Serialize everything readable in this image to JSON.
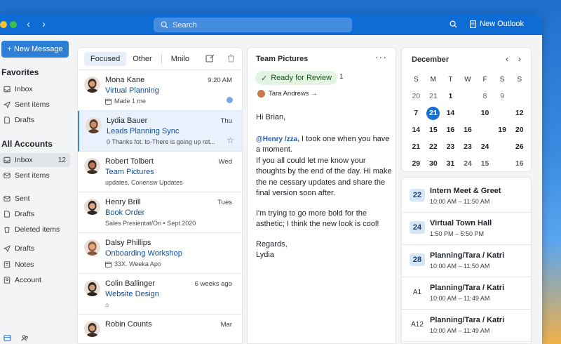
{
  "titlebar": {
    "search_placeholder": "Search",
    "new_outlook_label": "New Outlook"
  },
  "sidebar": {
    "new_message_label": "+ New Message",
    "favorites_title": "Favorites",
    "favorites": [
      {
        "label": "Inbox",
        "icon": "inbox-icon"
      },
      {
        "label": "Sent items",
        "icon": "send-icon"
      },
      {
        "label": "Drafts",
        "icon": "drafts-icon"
      }
    ],
    "accounts_title": "All Accounts",
    "accounts": [
      {
        "label": "Inbox",
        "count": "12",
        "icon": "inbox-icon"
      },
      {
        "label": "Sent items",
        "icon": "sent-icon"
      },
      {
        "label": "Sent",
        "icon": "sent-icon"
      },
      {
        "label": "Drafts",
        "icon": "drafts-icon"
      },
      {
        "label": "Deleted items",
        "icon": "trash-icon"
      },
      {
        "label": "Drafts",
        "icon": "send-icon"
      },
      {
        "label": "Notes",
        "icon": "notes-icon"
      },
      {
        "label": "Account",
        "icon": "account-icon"
      }
    ]
  },
  "list": {
    "tabs": [
      "Focused",
      "Other",
      "Mnilo"
    ],
    "mails": [
      {
        "sender": "Mona Kane",
        "subject": "Virtual Planning",
        "preview": "Made 1 me",
        "time": "9:20 AM",
        "unread": true
      },
      {
        "sender": "Lydia Bauer",
        "subject": "Leads Planning Sync",
        "preview": "0  Thanks fot. to-There is going up ret...",
        "time": "Thu",
        "selected": true
      },
      {
        "sender": "Robert Tolbert",
        "subject": "Team Pictures",
        "preview": "updates, Conensw Updates",
        "time": "Wed"
      },
      {
        "sender": "Henry Brill",
        "subject": "Book Order",
        "preview": "Sales Presientat/Ori • Sept.2020",
        "time": "Tues"
      },
      {
        "sender": "Dalsy Phillips",
        "subject": "Onboarding Workshop",
        "preview": "33X. Weeka Apo",
        "time": ""
      },
      {
        "sender": "Colin Ballinger",
        "subject": "Website Design",
        "preview": "",
        "time": "6 weeks ago"
      },
      {
        "sender": "Robin Counts",
        "subject": "",
        "preview": "",
        "time": "Mar"
      }
    ]
  },
  "reading": {
    "title": "Team Pictures",
    "status_label": "Ready for Review",
    "status_count": "1",
    "from": "Tara Andrews →",
    "greeting": "Hi Brian,",
    "mention": "@Henry /zza,",
    "p1_rest": " I took one when you have a moment.",
    "p1b": "If you all could let me know your thoughts by the end of the day. Hi make the ne cessary updates and share the final version soon after.",
    "p2": "I'm trying to go more bold for the asthetic; I think the new look is cool!",
    "signoff": "Regards,",
    "signature": "Lydia"
  },
  "calendar": {
    "month": "December",
    "weekdays": [
      "S",
      "M",
      "T",
      "W",
      "F",
      "S",
      "S"
    ],
    "days": [
      [
        "20",
        "21",
        "1",
        "",
        "8",
        "9"
      ],
      [
        "7",
        "21",
        "14",
        "10",
        "12"
      ],
      [
        "14",
        "15",
        "16",
        "16",
        "19",
        "20"
      ],
      [
        "21",
        "22",
        "23",
        "23",
        "24",
        "26"
      ],
      [
        "29",
        "30",
        "31",
        "24",
        "15",
        "16"
      ]
    ],
    "events": [
      {
        "date": "22",
        "title": "Intern Meet & Greet",
        "time": "10:00 AM – 11:50 AM",
        "badge": true
      },
      {
        "date": "24",
        "title": "Virtual Town Hall",
        "time": "1:50 PM – 5:50 PM",
        "badge": true
      },
      {
        "date": "28",
        "title": "Planning/Tara / Katri",
        "time": "10:00 AM – 11:50 AM",
        "badge": true
      },
      {
        "date": "A1",
        "title": "Planning/Tara / Katri",
        "time": "10:00 AM – 11:49 AM",
        "badge": false
      },
      {
        "date": "A12",
        "title": "Planning/Tara / Katri",
        "time": "10:00 AM – 11:49 AM",
        "badge": false
      }
    ]
  },
  "colors": {
    "accent": "#0f6cd5",
    "today": "#1a6fd4",
    "ready_bg": "#e4f4e2"
  }
}
